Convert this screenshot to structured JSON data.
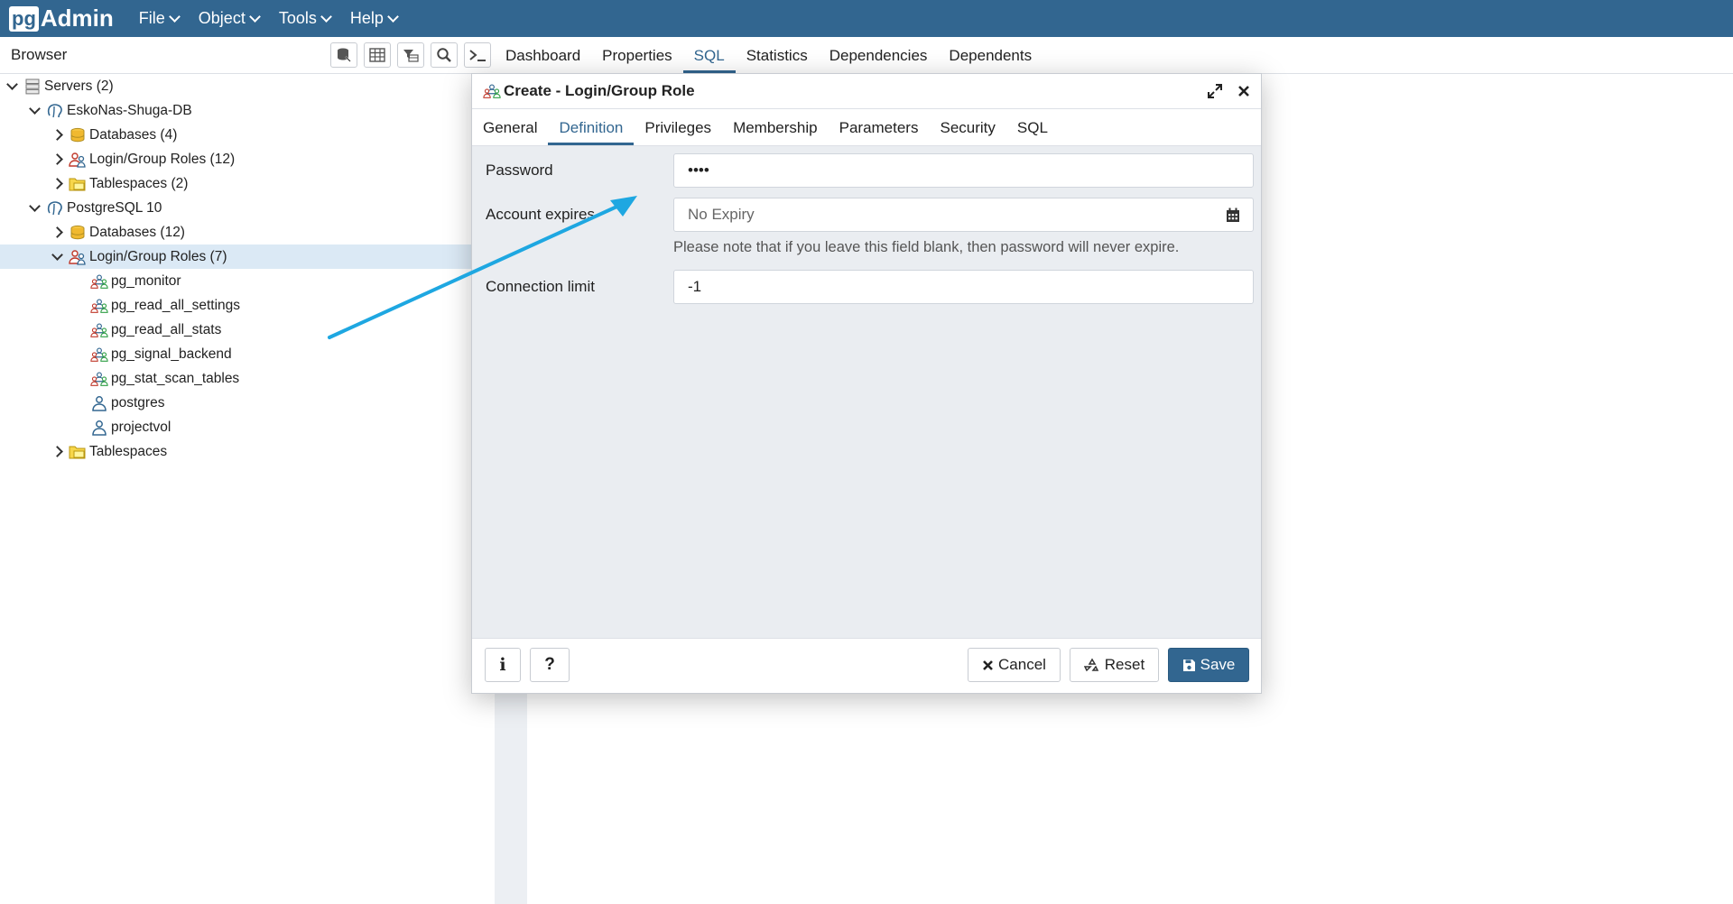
{
  "app": {
    "logo_pg": "pg",
    "logo_admin": "Admin"
  },
  "menu": [
    {
      "label": "File"
    },
    {
      "label": "Object"
    },
    {
      "label": "Tools"
    },
    {
      "label": "Help"
    }
  ],
  "browser": {
    "title": "Browser"
  },
  "main_tabs": [
    {
      "label": "Dashboard"
    },
    {
      "label": "Properties"
    },
    {
      "label": "SQL",
      "active": true
    },
    {
      "label": "Statistics"
    },
    {
      "label": "Dependencies"
    },
    {
      "label": "Dependents"
    }
  ],
  "tree": [
    {
      "label": "Servers (2)",
      "level": 0,
      "toggle": "down",
      "icon": "servers-icon"
    },
    {
      "label": "EskoNas-Shuga-DB",
      "level": 1,
      "toggle": "down",
      "icon": "server-elephant-icon"
    },
    {
      "label": "Databases (4)",
      "level": 2,
      "toggle": "right",
      "icon": "databases-icon"
    },
    {
      "label": "Login/Group Roles (12)",
      "level": 2,
      "toggle": "right",
      "icon": "roles-icon"
    },
    {
      "label": "Tablespaces (2)",
      "level": 2,
      "toggle": "right",
      "icon": "tablespaces-icon"
    },
    {
      "label": "PostgreSQL 10",
      "level": 1,
      "toggle": "down",
      "icon": "server-elephant-icon"
    },
    {
      "label": "Databases (12)",
      "level": 2,
      "toggle": "right",
      "icon": "databases-icon"
    },
    {
      "label": "Login/Group Roles (7)",
      "level": 2,
      "toggle": "down",
      "icon": "roles-icon",
      "selected": true
    },
    {
      "label": "pg_monitor",
      "level": 3,
      "toggle": "",
      "icon": "group-role-icon"
    },
    {
      "label": "pg_read_all_settings",
      "level": 3,
      "toggle": "",
      "icon": "group-role-icon"
    },
    {
      "label": "pg_read_all_stats",
      "level": 3,
      "toggle": "",
      "icon": "group-role-icon"
    },
    {
      "label": "pg_signal_backend",
      "level": 3,
      "toggle": "",
      "icon": "group-role-icon"
    },
    {
      "label": "pg_stat_scan_tables",
      "level": 3,
      "toggle": "",
      "icon": "group-role-icon"
    },
    {
      "label": "postgres",
      "level": 3,
      "toggle": "",
      "icon": "user-role-icon"
    },
    {
      "label": "projectvol",
      "level": 3,
      "toggle": "",
      "icon": "user-role-icon"
    },
    {
      "label": "Tablespaces",
      "level": 2,
      "toggle": "right",
      "icon": "tablespaces-icon"
    }
  ],
  "dialog": {
    "title": "Create - Login/Group Role",
    "tabs": [
      {
        "label": "General"
      },
      {
        "label": "Definition",
        "active": true
      },
      {
        "label": "Privileges"
      },
      {
        "label": "Membership"
      },
      {
        "label": "Parameters"
      },
      {
        "label": "Security"
      },
      {
        "label": "SQL"
      }
    ],
    "form": {
      "password_label": "Password",
      "password_value": "••••",
      "account_expires_label": "Account expires",
      "account_expires_placeholder": "No Expiry",
      "expiry_note": "Please note that if you leave this field blank, then password will never expire.",
      "connection_limit_label": "Connection limit",
      "connection_limit_value": "-1"
    },
    "footer": {
      "info_label": "i",
      "help_label": "?",
      "cancel_label": "Cancel",
      "reset_label": "Reset",
      "save_label": "Save"
    }
  },
  "colors": {
    "brand": "#326690",
    "selected_row": "#dbe9f5",
    "arrow_annotation": "#1ea7e1"
  }
}
